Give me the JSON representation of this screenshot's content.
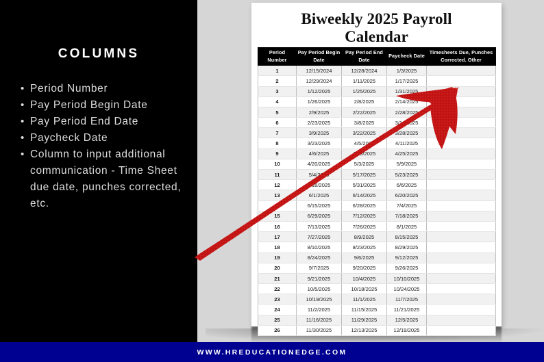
{
  "left_panel": {
    "heading": "COLUMNS",
    "bullets": [
      "Period Number",
      "Pay Period Begin Date",
      "Pay Period End Date",
      "Paycheck Date",
      "Column to input additional communication - Time Sheet due date, punches corrected, etc."
    ],
    "background_color": "#000000",
    "text_color": "#dedede"
  },
  "document": {
    "title": "Biweekly 2025 Payroll Calendar",
    "paper_color": "#ffffff",
    "table": {
      "headers": [
        "Period Number",
        "Pay Period Begin Date",
        "Pay Period End Date",
        "Paycheck Date",
        "Timesheets Due, Punches Corrected. Other"
      ],
      "header_background": "#000000",
      "header_text_color": "#ffffff",
      "rows": [
        {
          "number": "1",
          "begin": "12/15/2024",
          "end": "12/28/2024",
          "paycheck": "1/3/2025",
          "notes": ""
        },
        {
          "number": "2",
          "begin": "12/29/2024",
          "end": "1/11/2025",
          "paycheck": "1/17/2025",
          "notes": ""
        },
        {
          "number": "3",
          "begin": "1/12/2025",
          "end": "1/25/2025",
          "paycheck": "1/31/2025",
          "notes": ""
        },
        {
          "number": "4",
          "begin": "1/26/2025",
          "end": "2/8/2025",
          "paycheck": "2/14/2025",
          "notes": ""
        },
        {
          "number": "5",
          "begin": "2/9/2025",
          "end": "2/22/2025",
          "paycheck": "2/28/2025",
          "notes": ""
        },
        {
          "number": "6",
          "begin": "2/23/2025",
          "end": "3/8/2025",
          "paycheck": "3/14/2025",
          "notes": ""
        },
        {
          "number": "7",
          "begin": "3/9/2025",
          "end": "3/22/2025",
          "paycheck": "3/28/2025",
          "notes": ""
        },
        {
          "number": "8",
          "begin": "3/23/2025",
          "end": "4/5/2025",
          "paycheck": "4/11/2025",
          "notes": ""
        },
        {
          "number": "9",
          "begin": "4/6/2025",
          "end": "4/19/2025",
          "paycheck": "4/25/2025",
          "notes": ""
        },
        {
          "number": "10",
          "begin": "4/20/2025",
          "end": "5/3/2025",
          "paycheck": "5/9/2025",
          "notes": ""
        },
        {
          "number": "11",
          "begin": "5/4/2025",
          "end": "5/17/2025",
          "paycheck": "5/23/2025",
          "notes": ""
        },
        {
          "number": "12",
          "begin": "5/18/2025",
          "end": "5/31/2025",
          "paycheck": "6/6/2025",
          "notes": ""
        },
        {
          "number": "13",
          "begin": "6/1/2025",
          "end": "6/14/2025",
          "paycheck": "6/20/2025",
          "notes": ""
        },
        {
          "number": "14",
          "begin": "6/15/2025",
          "end": "6/28/2025",
          "paycheck": "7/4/2025",
          "notes": ""
        },
        {
          "number": "15",
          "begin": "6/29/2025",
          "end": "7/12/2025",
          "paycheck": "7/18/2025",
          "notes": ""
        },
        {
          "number": "16",
          "begin": "7/13/2025",
          "end": "7/26/2025",
          "paycheck": "8/1/2025",
          "notes": ""
        },
        {
          "number": "17",
          "begin": "7/27/2025",
          "end": "8/9/2025",
          "paycheck": "8/15/2025",
          "notes": ""
        },
        {
          "number": "18",
          "begin": "8/10/2025",
          "end": "8/23/2025",
          "paycheck": "8/29/2025",
          "notes": ""
        },
        {
          "number": "19",
          "begin": "8/24/2025",
          "end": "9/6/2025",
          "paycheck": "9/12/2025",
          "notes": ""
        },
        {
          "number": "20",
          "begin": "9/7/2025",
          "end": "9/20/2025",
          "paycheck": "9/26/2025",
          "notes": ""
        },
        {
          "number": "21",
          "begin": "9/21/2025",
          "end": "10/4/2025",
          "paycheck": "10/10/2025",
          "notes": ""
        },
        {
          "number": "22",
          "begin": "10/5/2025",
          "end": "10/18/2025",
          "paycheck": "10/24/2025",
          "notes": ""
        },
        {
          "number": "23",
          "begin": "10/19/2025",
          "end": "11/1/2025",
          "paycheck": "11/7/2025",
          "notes": ""
        },
        {
          "number": "24",
          "begin": "11/2/2025",
          "end": "11/15/2025",
          "paycheck": "11/21/2025",
          "notes": ""
        },
        {
          "number": "25",
          "begin": "11/16/2025",
          "end": "11/29/2025",
          "paycheck": "12/5/2025",
          "notes": ""
        },
        {
          "number": "26",
          "begin": "11/30/2025",
          "end": "12/13/2025",
          "paycheck": "12/19/2025",
          "notes": ""
        }
      ]
    }
  },
  "annotation": {
    "arrow_color": "#cc1111",
    "arrow_name": "red-arrow-annotation"
  },
  "banner": {
    "url": "WWW.HREDUCATIONEDGE.COM",
    "background_color": "#000091",
    "text_color": "#ffffff"
  }
}
